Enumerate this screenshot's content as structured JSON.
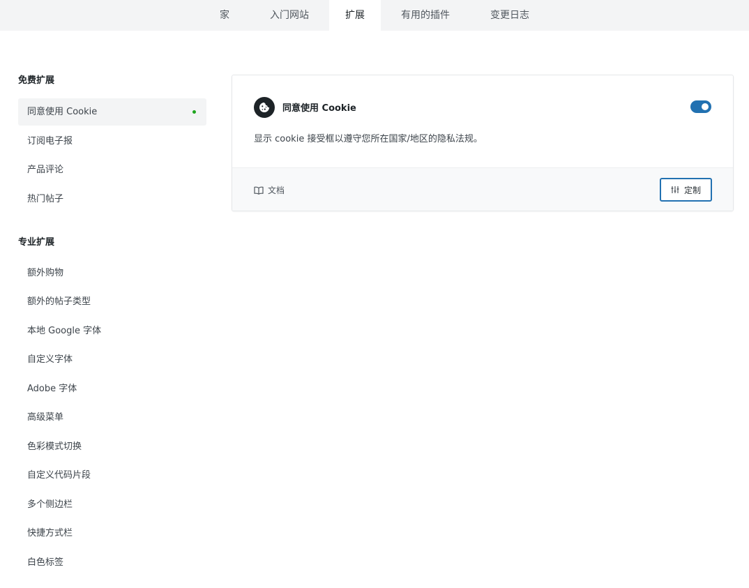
{
  "topnav": {
    "tabs": [
      {
        "label": "家"
      },
      {
        "label": "入门网站"
      },
      {
        "label": "扩展"
      },
      {
        "label": "有用的插件"
      },
      {
        "label": "变更日志"
      }
    ],
    "active_index": 2
  },
  "sidebar": {
    "free_title": "免费扩展",
    "free_items": [
      {
        "label": "同意使用 Cookie"
      },
      {
        "label": "订阅电子报"
      },
      {
        "label": "产品评论"
      },
      {
        "label": "热门帖子"
      }
    ],
    "pro_title": "专业扩展",
    "pro_items": [
      {
        "label": "额外购物"
      },
      {
        "label": "额外的帖子类型"
      },
      {
        "label": "本地 Google 字体"
      },
      {
        "label": "自定义字体"
      },
      {
        "label": "Adobe 字体"
      },
      {
        "label": "高级菜单"
      },
      {
        "label": "色彩模式切换"
      },
      {
        "label": "自定义代码片段"
      },
      {
        "label": "多个侧边栏"
      },
      {
        "label": "快捷方式栏"
      },
      {
        "label": "白色标签"
      }
    ]
  },
  "card": {
    "icon": "cookie-icon",
    "title": "同意使用 Cookie",
    "enabled": true,
    "description": "显示 cookie 接受框以遵守您所在国家/地区的隐私法规。",
    "docs_icon": "book-icon",
    "docs_label": "文档",
    "customize_icon": "sliders-icon",
    "customize_label": "定制"
  },
  "colors": {
    "accent": "#2271b1",
    "active_dot": "#1ea51e",
    "topnav_bg": "#f3f4f5",
    "footer_bg": "#f8f9fa"
  }
}
